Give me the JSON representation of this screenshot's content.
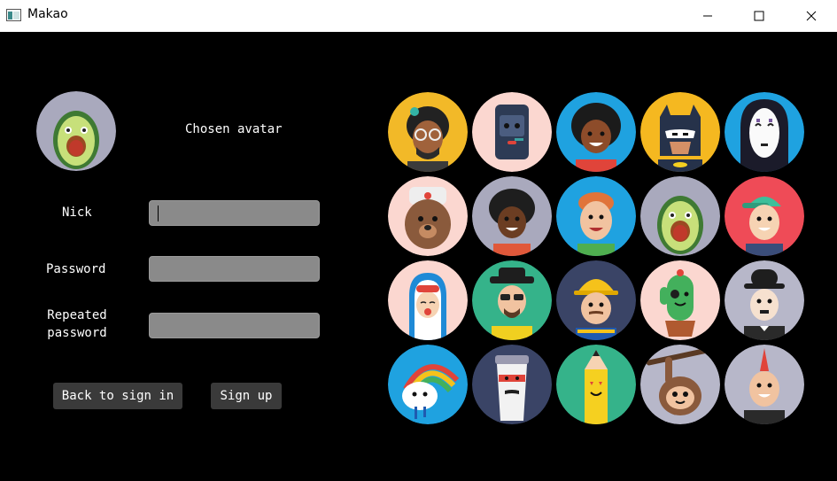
{
  "window": {
    "title": "Makao",
    "icon": "app-window-icon",
    "controls": [
      "minimize-icon",
      "maximize-icon",
      "close-icon"
    ]
  },
  "form": {
    "chosen_avatar_label": "Chosen avatar",
    "chosen_avatar": "avocado",
    "nick_label": "Nick",
    "nick_value": "",
    "password_label": "Password",
    "password_value": "",
    "repeated_password_label_line1": "Repeated",
    "repeated_password_label_line2": "password",
    "repeated_password_value": "",
    "back_button": "Back to sign in",
    "signup_button": "Sign up"
  },
  "avatars": [
    [
      "afro-glasses-man-avatar",
      "robot-screen-avatar",
      "curly-woman-avatar",
      "batman-avatar",
      "no-face-mask-avatar"
    ],
    [
      "bear-ushanka-avatar",
      "afro-boy-avatar",
      "ginger-boy-avatar",
      "avocado-avatar",
      "cap-boy-avatar"
    ],
    [
      "baby-avatar",
      "heisenberg-avatar",
      "builder-avatar",
      "cactus-pirate-avatar",
      "chaplin-avatar"
    ],
    [
      "rainbow-cloud-avatar",
      "coffee-cup-avatar",
      "pencil-avatar",
      "sloth-avatar",
      "punk-avatar"
    ]
  ],
  "colors": {
    "background": "#000000",
    "field": "#8a8a8a",
    "button": "#3a3a3a"
  }
}
